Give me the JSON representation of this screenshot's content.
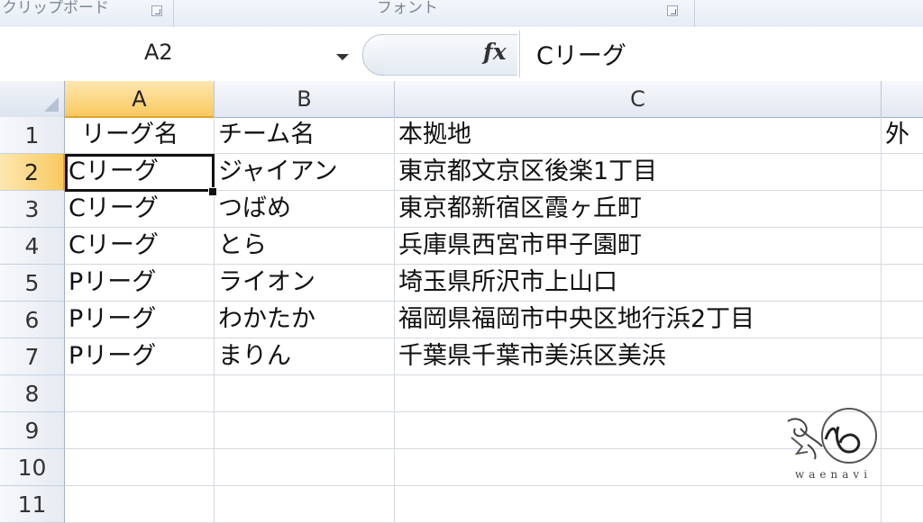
{
  "ribbon": {
    "groups": [
      {
        "label": "クリップボード"
      },
      {
        "label": "フォント"
      }
    ]
  },
  "formula_bar": {
    "name_box": "A2",
    "fx_label": "fx",
    "formula": "Cリーグ"
  },
  "sheet": {
    "columns": [
      "A",
      "B",
      "C",
      ""
    ],
    "rows": [
      {
        "num": "1",
        "cells": [
          "リーグ名",
          "チーム名",
          "本拠地",
          "外"
        ]
      },
      {
        "num": "2",
        "cells": [
          "Cリーグ",
          "ジャイアン",
          "東京都文京区後楽1丁目",
          ""
        ]
      },
      {
        "num": "3",
        "cells": [
          "Cリーグ",
          "つばめ",
          "東京都新宿区霞ヶ丘町",
          ""
        ]
      },
      {
        "num": "4",
        "cells": [
          "Cリーグ",
          "とら",
          "兵庫県西宮市甲子園町",
          ""
        ]
      },
      {
        "num": "5",
        "cells": [
          "Pリーグ",
          "ライオン",
          "埼玉県所沢市上山口",
          ""
        ]
      },
      {
        "num": "6",
        "cells": [
          "Pリーグ",
          "わかたか",
          "福岡県福岡市中央区地行浜2丁目",
          ""
        ]
      },
      {
        "num": "7",
        "cells": [
          "Pリーグ",
          "まりん",
          "千葉県千葉市美浜区美浜",
          ""
        ]
      },
      {
        "num": "8",
        "cells": [
          "",
          "",
          "",
          ""
        ]
      },
      {
        "num": "9",
        "cells": [
          "",
          "",
          "",
          ""
        ]
      },
      {
        "num": "10",
        "cells": [
          "",
          "",
          "",
          ""
        ]
      },
      {
        "num": "11",
        "cells": [
          "",
          "",
          "",
          ""
        ]
      }
    ],
    "active_cell": "A2",
    "selected_column": "A",
    "selected_row": "2"
  },
  "watermark": {
    "text": "waenavi"
  }
}
